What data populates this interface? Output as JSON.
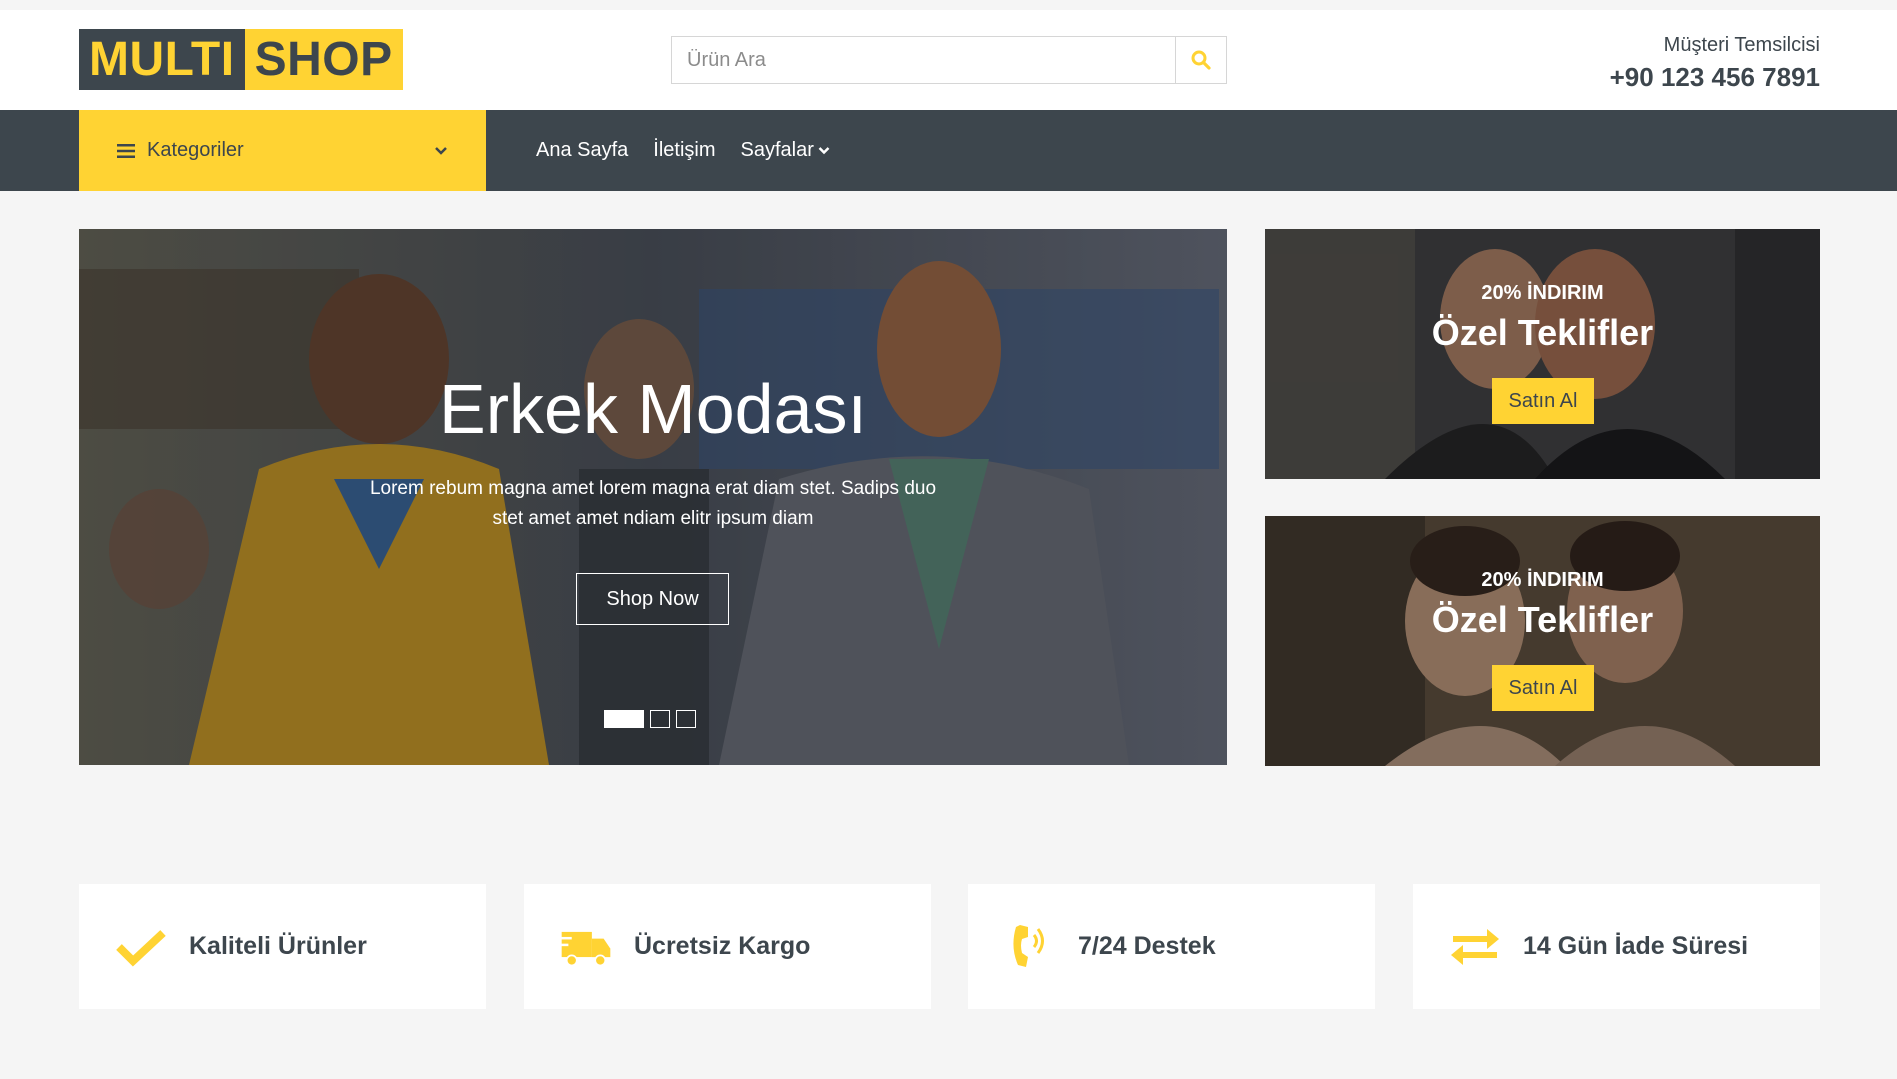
{
  "brand": {
    "part1": "MULTI",
    "part2": "SHOP"
  },
  "search": {
    "placeholder": "Ürün Ara",
    "value": "",
    "icon": "search-icon"
  },
  "contact": {
    "label": "Müşteri Temsilcisi",
    "phone": "+90 123 456 7891"
  },
  "nav": {
    "categories_label": "Kategoriler",
    "links": [
      {
        "label": "Ana Sayfa"
      },
      {
        "label": "İletişim"
      },
      {
        "label": "Sayfalar"
      }
    ]
  },
  "hero": {
    "title": "Erkek Modası",
    "text": "Lorem rebum magna amet lorem magna erat diam stet. Sadips duo stet amet amet ndiam elitr ipsum diam",
    "button": "Shop Now",
    "slides": 3,
    "active_slide": 1
  },
  "offers": [
    {
      "discount": "20% İNDIRIM",
      "title": "Özel Teklifler",
      "button": "Satın Al"
    },
    {
      "discount": "20% İNDIRIM",
      "title": "Özel Teklifler",
      "button": "Satın Al"
    }
  ],
  "features": [
    {
      "label": "Kaliteli Ürünler",
      "icon": "check-icon"
    },
    {
      "label": "Ücretsiz Kargo",
      "icon": "truck-icon"
    },
    {
      "label": "7/24 Destek",
      "icon": "phone-volume-icon"
    },
    {
      "label": "14 Gün İade Süresi",
      "icon": "exchange-icon"
    }
  ],
  "colors": {
    "accent": "#FFD333",
    "dark": "#3D464D",
    "light_bg": "#F5F5F5"
  }
}
